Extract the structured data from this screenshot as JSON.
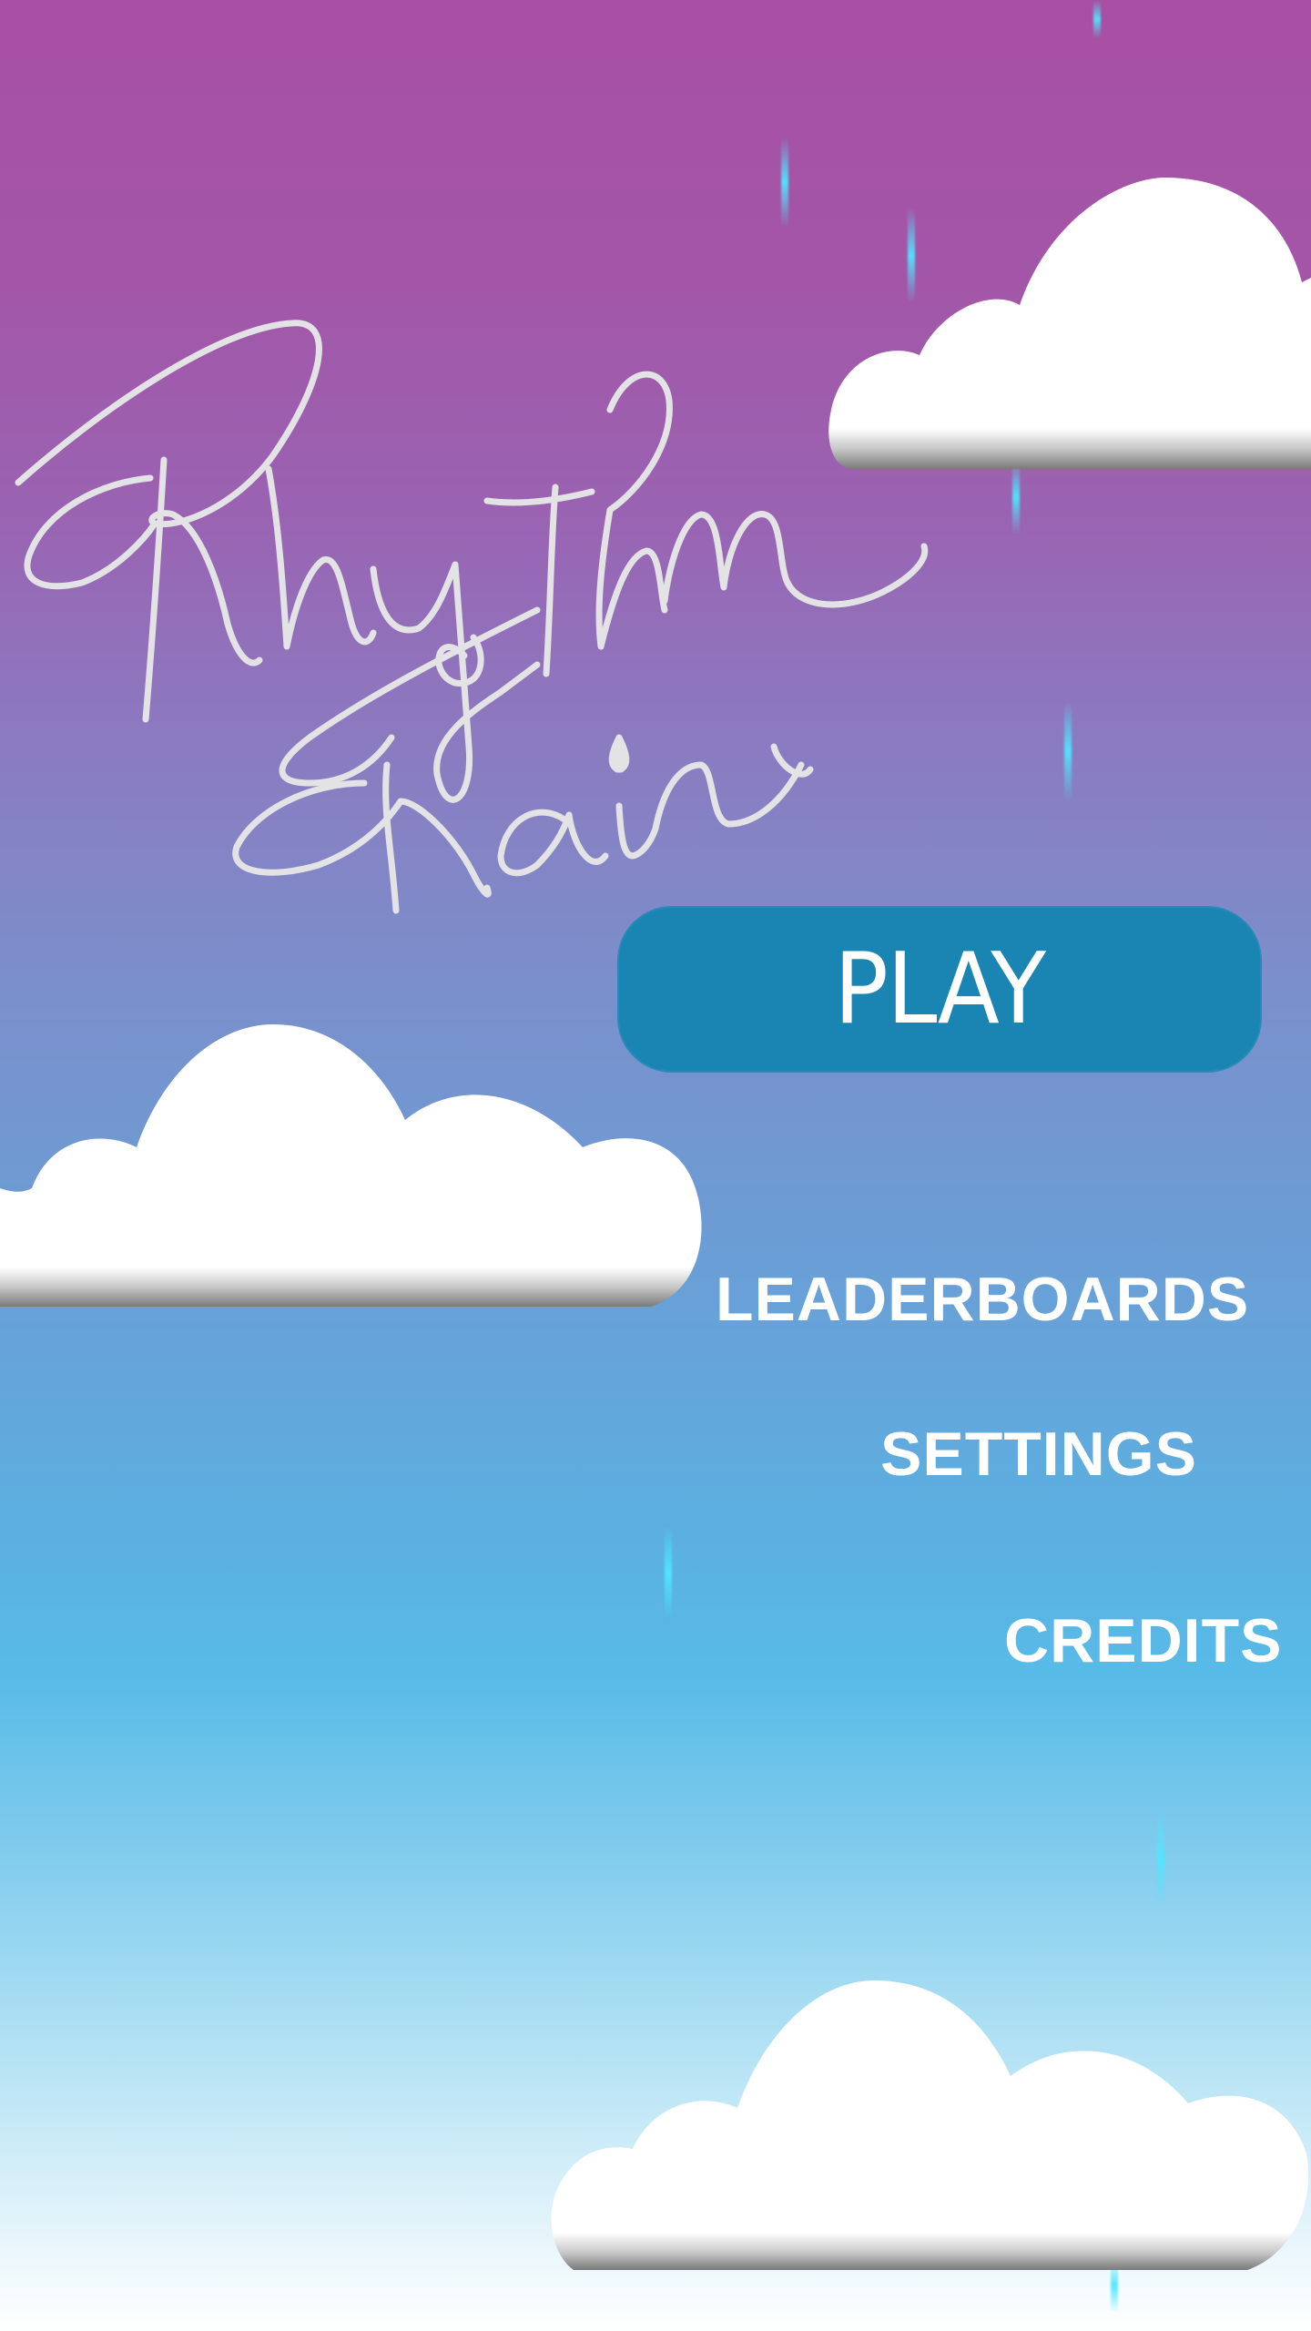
{
  "app": {
    "title": "Rhythm Rain"
  },
  "menu": {
    "play_label": "PLAY",
    "leaderboards_label": "LEADERBOARDS",
    "settings_label": "SETTINGS",
    "credits_label": "CREDITS"
  },
  "colors": {
    "sky_top": "#a84fa3",
    "sky_middle": "#7b8fcb",
    "sky_bottom": "#ffffff",
    "play_button": "#1a84b3",
    "raindrop": "#50e6ff",
    "cloud": "#ffffff",
    "logo_stroke": "#e3e3e6"
  }
}
